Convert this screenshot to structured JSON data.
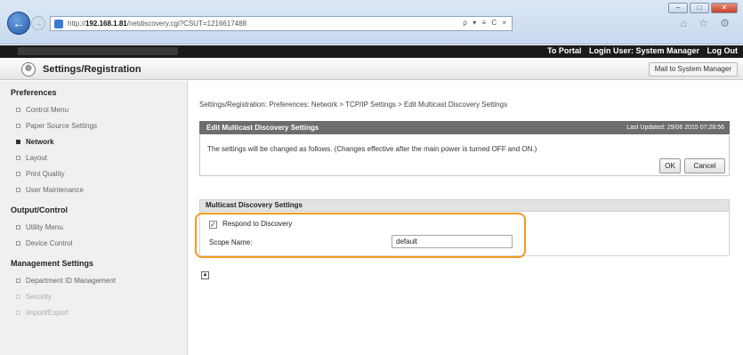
{
  "browser": {
    "url_prefix": "http://",
    "url_host": "192.168.1.81",
    "url_path": "/netdiscovery.cgi?CSUT=1216617488",
    "address_tools": "ρ ▾ ≡ C ×",
    "window_buttons": [
      "–",
      "□",
      "✕"
    ],
    "toolbar_icons": "⌂ ☆ ⚙"
  },
  "header": {
    "to_portal": "To Portal",
    "login_user_label": "Login User: System Manager",
    "log_out": "Log Out"
  },
  "title_bar": {
    "title": "Settings/Registration",
    "mail_button": "Mail to System Manager"
  },
  "sidebar": {
    "groups": [
      {
        "heading": "Preferences",
        "items": [
          {
            "label": "Control Menu"
          },
          {
            "label": "Paper Source Settings"
          },
          {
            "label": "Network"
          },
          {
            "label": "Layout"
          },
          {
            "label": "Print Quality"
          },
          {
            "label": "User Maintenance"
          }
        ]
      },
      {
        "heading": "Output/Control",
        "items": [
          {
            "label": "Utility Menu"
          },
          {
            "label": "Device Control"
          }
        ]
      },
      {
        "heading": "Management Settings",
        "items": [
          {
            "label": "Department ID Management"
          },
          {
            "label": "Security"
          },
          {
            "label": "Import/Export"
          }
        ]
      }
    ],
    "active_item": "Network"
  },
  "main": {
    "breadcrumb": "Settings/Registration: Preferences: Network > TCP/IP Settings > Edit Multicast Discovery Settings",
    "panel_title": "Edit Multicast Discovery Settings",
    "last_updated": "Last Updated: 29/06 2015 07:28:56",
    "notice": "The settings will be changed as follows. (Changes effective after the main power is turned OFF and ON.)",
    "ok_button": "OK",
    "cancel_button": "Cancel",
    "section_title": "Multicast Discovery Settings",
    "respond_label": "Respond to Discovery",
    "respond_checked": true,
    "scope_label": "Scope Name:",
    "scope_value": "default",
    "highlight_color": "#f29a1f"
  }
}
